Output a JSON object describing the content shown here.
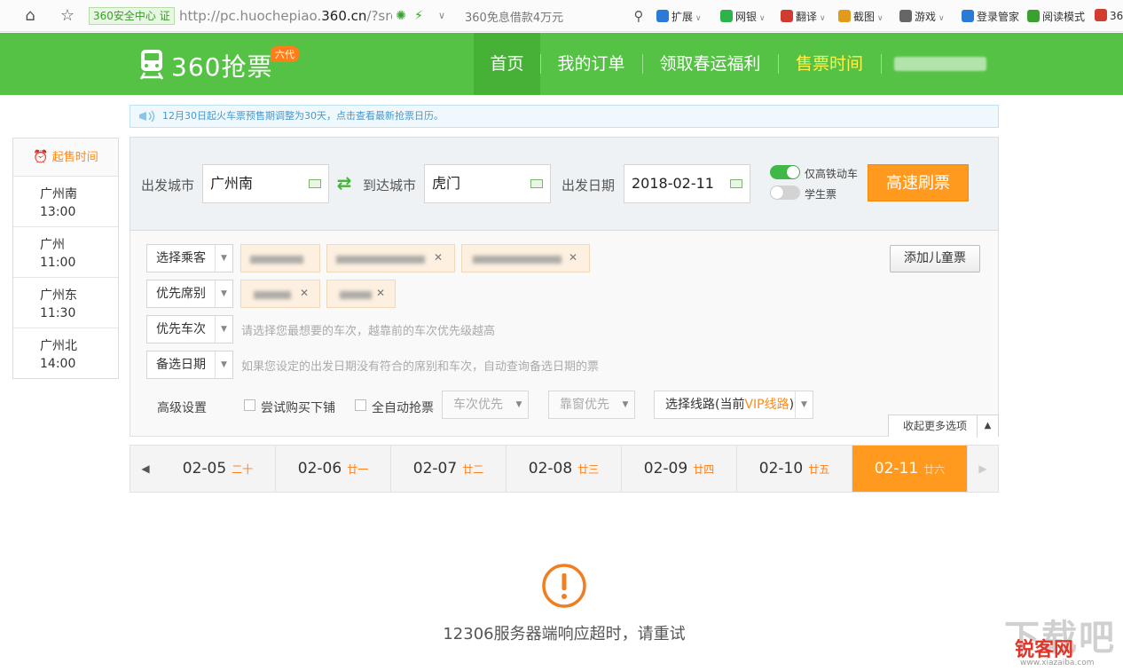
{
  "browser": {
    "cert_label": "360安全中心 证",
    "url_prefix": "http://pc.huochepiao.",
    "url_domain": "360.cn",
    "url_suffix": "/?src",
    "search_suggestion": "360免息借款4万元",
    "extensions": [
      {
        "label": "扩展",
        "color": "#2a7ad6"
      },
      {
        "label": "网银",
        "color": "#2db34a"
      },
      {
        "label": "翻译",
        "color": "#d23b2f"
      },
      {
        "label": "截图",
        "color": "#e19a1b"
      },
      {
        "label": "游戏",
        "color": "#666666"
      },
      {
        "label": "登录管家",
        "color": "#2a7ad6"
      },
      {
        "label": "阅读模式",
        "color": "#3aa030"
      },
      {
        "label": "36",
        "color": "#d23b2f"
      }
    ]
  },
  "header": {
    "logo_text": "360抢票",
    "logo_badge": "六代",
    "nav": [
      {
        "label": "首页",
        "active": true
      },
      {
        "label": "我的订单"
      },
      {
        "label": "领取春运福利"
      },
      {
        "label": "售票时间",
        "highlight": true
      }
    ]
  },
  "notice": {
    "text": "12月30日起火车票预售期调整为30天，点击查看最新抢票日历。"
  },
  "sale_times": {
    "title": "起售时间",
    "rows": [
      {
        "station": "广州南",
        "time": "13:00"
      },
      {
        "station": "广州",
        "time": "11:00"
      },
      {
        "station": "广州东",
        "time": "11:30"
      },
      {
        "station": "广州北",
        "time": "14:00"
      }
    ]
  },
  "query": {
    "from_label": "出发城市",
    "from_value": "广州南",
    "to_label": "到达城市",
    "to_value": "虎门",
    "date_label": "出发日期",
    "date_value": "2018-02-11",
    "toggle_highspeed": "仅高铁动车",
    "toggle_student": "学生票",
    "search_button": "高速刷票"
  },
  "options": {
    "passenger_select": "选择乘客",
    "seat_select": "优先席别",
    "train_select": "优先车次",
    "train_hint": "请选择您最想要的车次，越靠前的车次优先级越高",
    "backup_date_select": "备选日期",
    "backup_date_hint": "如果您设定的出发日期没有符合的席别和车次，自动查询备选日期的票",
    "add_child_button": "添加儿童票",
    "advanced_label": "高级设置",
    "try_lower_berth": "尝试购买下铺",
    "auto_grab": "全自动抢票",
    "train_priority": "车次优先",
    "window_priority": "靠窗优先",
    "route_prefix": "选择线路(当前",
    "route_vip": "VIP线路",
    "route_suffix": ")",
    "collapse_label": "收起更多选项"
  },
  "dates": [
    {
      "date": "02-05",
      "lunar": "二十"
    },
    {
      "date": "02-06",
      "lunar": "廿一"
    },
    {
      "date": "02-07",
      "lunar": "廿二"
    },
    {
      "date": "02-08",
      "lunar": "廿三"
    },
    {
      "date": "02-09",
      "lunar": "廿四"
    },
    {
      "date": "02-10",
      "lunar": "廿五"
    },
    {
      "date": "02-11",
      "lunar": "廿六",
      "active": true
    }
  ],
  "error": {
    "message": "12306服务器端响应超时，请重试"
  },
  "watermark": {
    "big": "下载吧",
    "brand": "锐客网",
    "url": "www.xiazaiba.com"
  },
  "colors": {
    "brand_green": "#55c245",
    "accent_orange": "#ff9a1e",
    "nav_highlight": "#fff34a"
  }
}
